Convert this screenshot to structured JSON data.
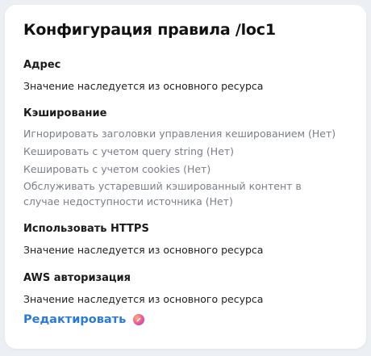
{
  "title": "Конфигурация правила /loc1",
  "sections": {
    "address": {
      "heading": "Адрес",
      "value": "Значение наследуется из основного ресурса"
    },
    "caching": {
      "heading": "Кэширование",
      "items": [
        "Игнорировать заголовки управления кешированием (Нет)",
        "Кешировать с учетом query string (Нет)",
        "Кешировать с учетом cookies (Нет)",
        "Обслуживать устаревший кэшированный контент в случае недоступности источника (Нет)"
      ]
    },
    "https": {
      "heading": "Использовать HTTPS",
      "value": "Значение наследуется из основного ресурса"
    },
    "aws": {
      "heading": "AWS авторизация",
      "value": "Значение наследуется из основного ресурса"
    }
  },
  "edit": {
    "label": "Редактировать",
    "icon": "edit-gradient-icon"
  },
  "colors": {
    "background": "#eceff3",
    "card": "#ffffff",
    "muted_text": "#7a7f87",
    "link": "#2b7ad8"
  }
}
